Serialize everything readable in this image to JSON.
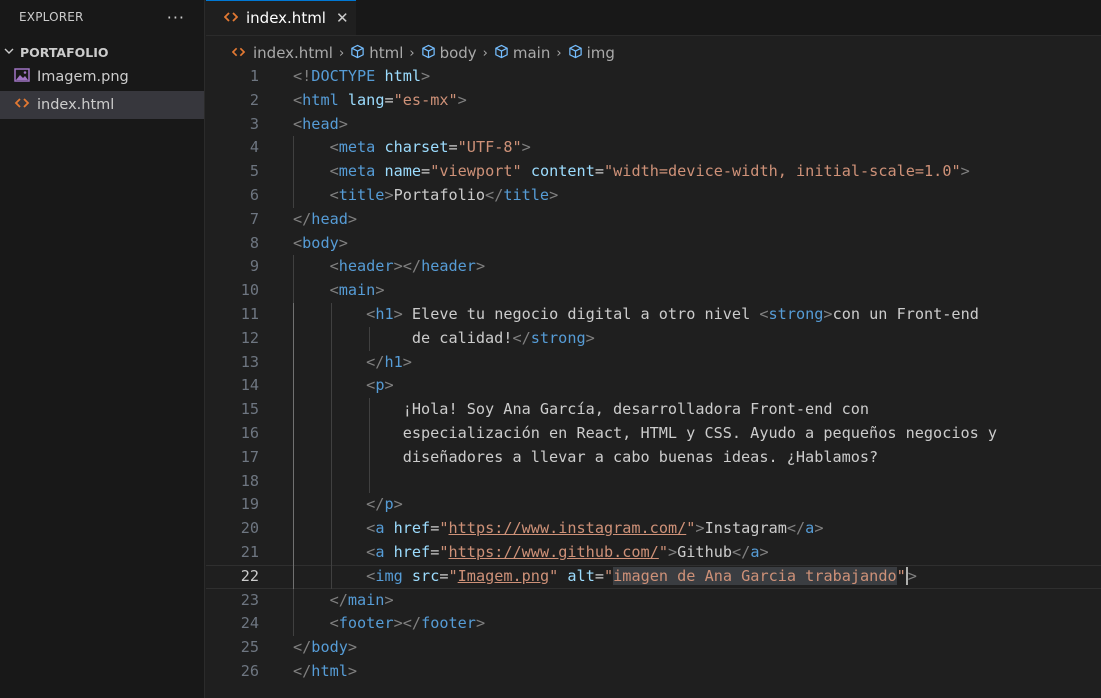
{
  "sidebar": {
    "title": "EXPLORER",
    "more_label": "···",
    "folder": "PORTAFOLIO",
    "files": [
      {
        "name": "Imagem.png",
        "icon": "image-file-icon"
      },
      {
        "name": "index.html",
        "icon": "html-file-icon"
      }
    ]
  },
  "tab": {
    "label": "index.html",
    "close_label": "✕"
  },
  "breadcrumb": [
    "index.html",
    "html",
    "body",
    "main",
    "img"
  ],
  "editor": {
    "current_line": 22,
    "line_numbers": [
      "1",
      "2",
      "3",
      "4",
      "5",
      "6",
      "7",
      "8",
      "9",
      "10",
      "11",
      "12",
      "13",
      "14",
      "15",
      "16",
      "17",
      "18",
      "19",
      "20",
      "21",
      "22",
      "23",
      "24",
      "25",
      "26"
    ],
    "lines": [
      "<!DOCTYPE html>",
      "<html lang=\"es-mx\">",
      "<head>",
      "    <meta charset=\"UTF-8\">",
      "    <meta name=\"viewport\" content=\"width=device-width, initial-scale=1.0\">",
      "    <title>Portafolio</title>",
      "</head>",
      "<body>",
      "    <header></header>",
      "    <main>",
      "        <h1> Eleve tu negocio digital a otro nivel <strong>con un Front-end",
      "             de calidad!</strong>",
      "        </h1>",
      "        <p>",
      "            ¡Hola! Soy Ana García, desarrolladora Front-end con",
      "            especialización en React, HTML y CSS. Ayudo a pequeños negocios y",
      "            diseñadores a llevar a cabo buenas ideas. ¿Hablamos?",
      "",
      "        </p>",
      "        <a href=\"https://www.instagram.com/\">Instagram</a>",
      "        <a href=\"https://www.github.com/\">Github</a>",
      "        <img src=\"Imagem.png\" alt=\"imagen de Ana Garcia trabajando\">",
      "    </main>",
      "    <footer></footer>",
      "</body>",
      "</html>"
    ]
  },
  "colors": {
    "accent": "#0078d4",
    "tag_bracket": "#808080",
    "tag_name": "#569cd6",
    "attribute": "#9cdcfe",
    "string": "#ce9178"
  }
}
